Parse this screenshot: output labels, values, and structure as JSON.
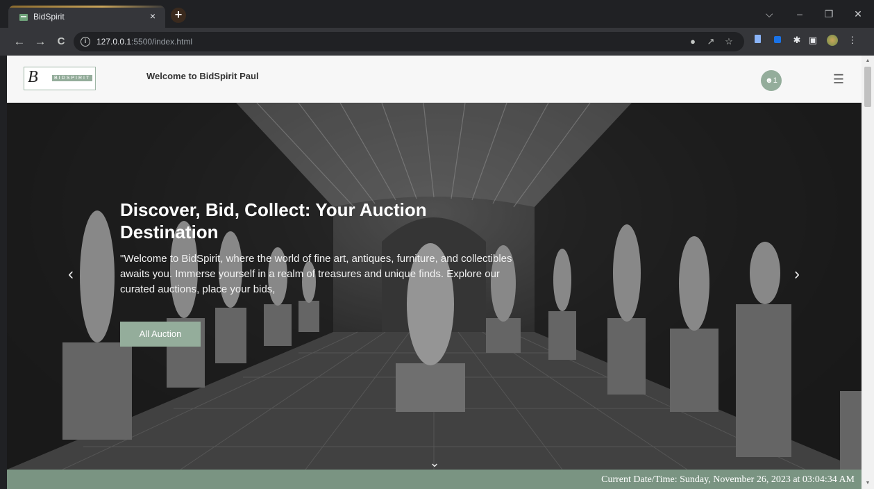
{
  "browser": {
    "tab_title": "BidSpirit",
    "tab_close": "×",
    "new_tab": "+",
    "url_host": "127.0.0.1",
    "url_rest": ":5500/index.html",
    "back": "←",
    "forward": "→",
    "reload": "C",
    "window_controls": {
      "menu": "⌵",
      "minimize": "–",
      "restore": "❐",
      "close": "✕"
    },
    "icons": [
      "location-pin-icon",
      "share-icon",
      "star-icon",
      "extension-icons",
      "profile-avatar-icon",
      "more-menu-icon"
    ]
  },
  "site": {
    "logo_letter": "B",
    "logo_text": "BIDSPIRIT",
    "welcome": "Welcome to BidSpirit Paul",
    "user_badge": "1",
    "menu_icon": "☰"
  },
  "hero": {
    "title": "Discover, Bid, Collect: Your Auction Destination",
    "text": "\"Welcome to BidSpirit, where the world of fine art, antiques, furniture, and collectibles awaits you. Immerse yourself in a realm of treasures and unique finds. Explore our curated auctions, place your bids,",
    "button": "All Auction",
    "prev": "‹",
    "next": "›",
    "scroll_down": "⌄"
  },
  "footer": {
    "datetime": "Current Date/Time: Sunday, November 26, 2023 at 03:04:34 AM"
  },
  "colors": {
    "accent_green": "#94ad9b",
    "footer_green": "#7a9482",
    "browser_dark": "#202124"
  }
}
